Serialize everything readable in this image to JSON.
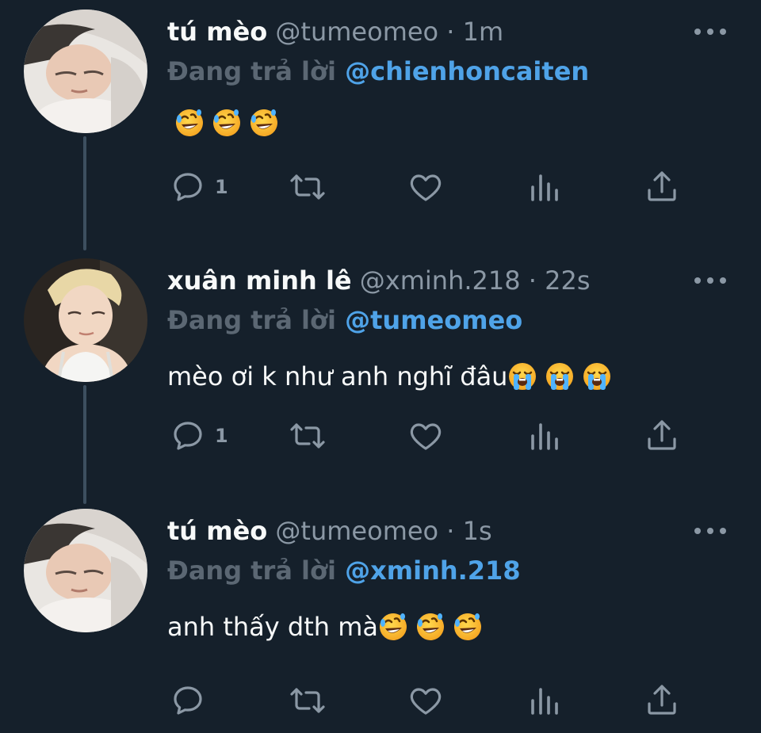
{
  "colors": {
    "background": "#15202b",
    "text_primary": "#f7f9f9",
    "text_secondary": "#8b98a5",
    "link": "#4fa3e8",
    "thread_line": "#3d4f5f"
  },
  "tweets": [
    {
      "name": "tú mèo",
      "handle": "@tumeomeo",
      "separator": "·",
      "time": "1m",
      "replying_label": "Đang trả lời",
      "replying_to": "@chienhoncaiten",
      "text": "",
      "emoji": "rolling-on-floor-laughing",
      "reply_count": "1"
    },
    {
      "name": "xuân minh lê",
      "handle": "@xminh.218",
      "separator": "·",
      "time": "22s",
      "replying_label": "Đang trả lời",
      "replying_to": "@tumeomeo",
      "text": "mèo ơi k như anh nghĩ đâu",
      "emoji": "loudly-crying-face",
      "reply_count": "1"
    },
    {
      "name": "tú mèo",
      "handle": "@tumeomeo",
      "separator": "·",
      "time": "1s",
      "replying_label": "Đang trả lời",
      "replying_to": "@xminh.218",
      "text": "anh thấy dth mà",
      "emoji": "rolling-on-floor-laughing",
      "reply_count": ""
    }
  ],
  "action_icons": [
    "reply-icon",
    "retweet-icon",
    "like-icon",
    "views-icon",
    "share-icon"
  ]
}
